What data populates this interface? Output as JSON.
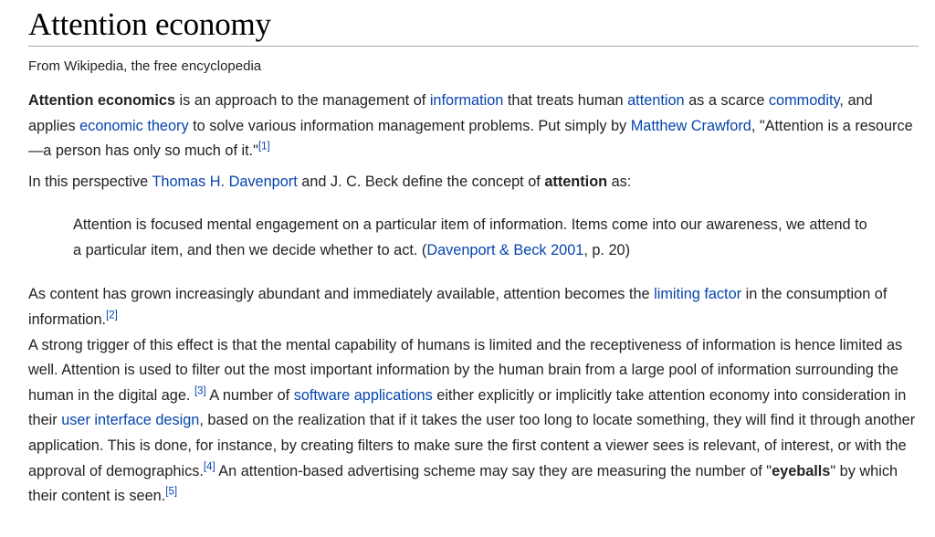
{
  "page": {
    "title": "Attention economy",
    "subtitle": "From Wikipedia, the free encyclopedia"
  },
  "para1": {
    "bold_term": "Attention economics",
    "t1": " is an approach to the management of ",
    "link_information": "information",
    "t2": " that treats human ",
    "link_attention": "attention",
    "t3": " as a scarce ",
    "link_commodity": "commodity",
    "t4": ", and applies ",
    "link_economic_theory": "economic theory",
    "t5": " to solve various information management problems. Put simply by ",
    "link_matthew_crawford": "Matthew Crawford",
    "t6": ", \"Attention is a resource—a person has only so much of it.\"",
    "ref": "[1]"
  },
  "para2": {
    "t1": "In this perspective ",
    "link_davenport": "Thomas H. Davenport",
    "t2": " and J. C. Beck define the concept of ",
    "bold_attention": "attention",
    "t3": " as:"
  },
  "quote": {
    "text": "Attention is focused mental engagement on a particular item of information. Items come into our awareness, we attend to a particular item, and then we decide whether to act. (",
    "link_citation": "Davenport & Beck 2001",
    "page_ref": ", p. 20)"
  },
  "para3": {
    "t1": "As content has grown increasingly abundant and immediately available, attention becomes the ",
    "link_limiting_factor": "limiting factor",
    "t2": " in the consumption of information.",
    "ref": "[2]"
  },
  "para4": {
    "t1": "A strong trigger of this effect is that the mental capability of humans is limited and the receptiveness of information is hence limited as well. Attention is used to filter out the most important information by the human brain from a large pool of information surrounding the human in the digital age. ",
    "ref3": "[3]",
    "t2": " A number of ",
    "link_software_applications": "software applications",
    "t3": " either explicitly or implicitly take attention economy into consideration in their ",
    "link_ui_design": "user interface design",
    "t4": ", based on the realization that if it takes the user too long to locate something, they will find it through another application. This is done, for instance, by creating filters to make sure the first content a viewer sees is relevant, of interest, or with the approval of demographics.",
    "ref4": "[4]",
    "t5": " An attention-based advertising scheme may say they are measuring the number of \"",
    "bold_eyeballs": "eyeballs",
    "t6": "\" by which their content is seen.",
    "ref5": "[5]"
  }
}
